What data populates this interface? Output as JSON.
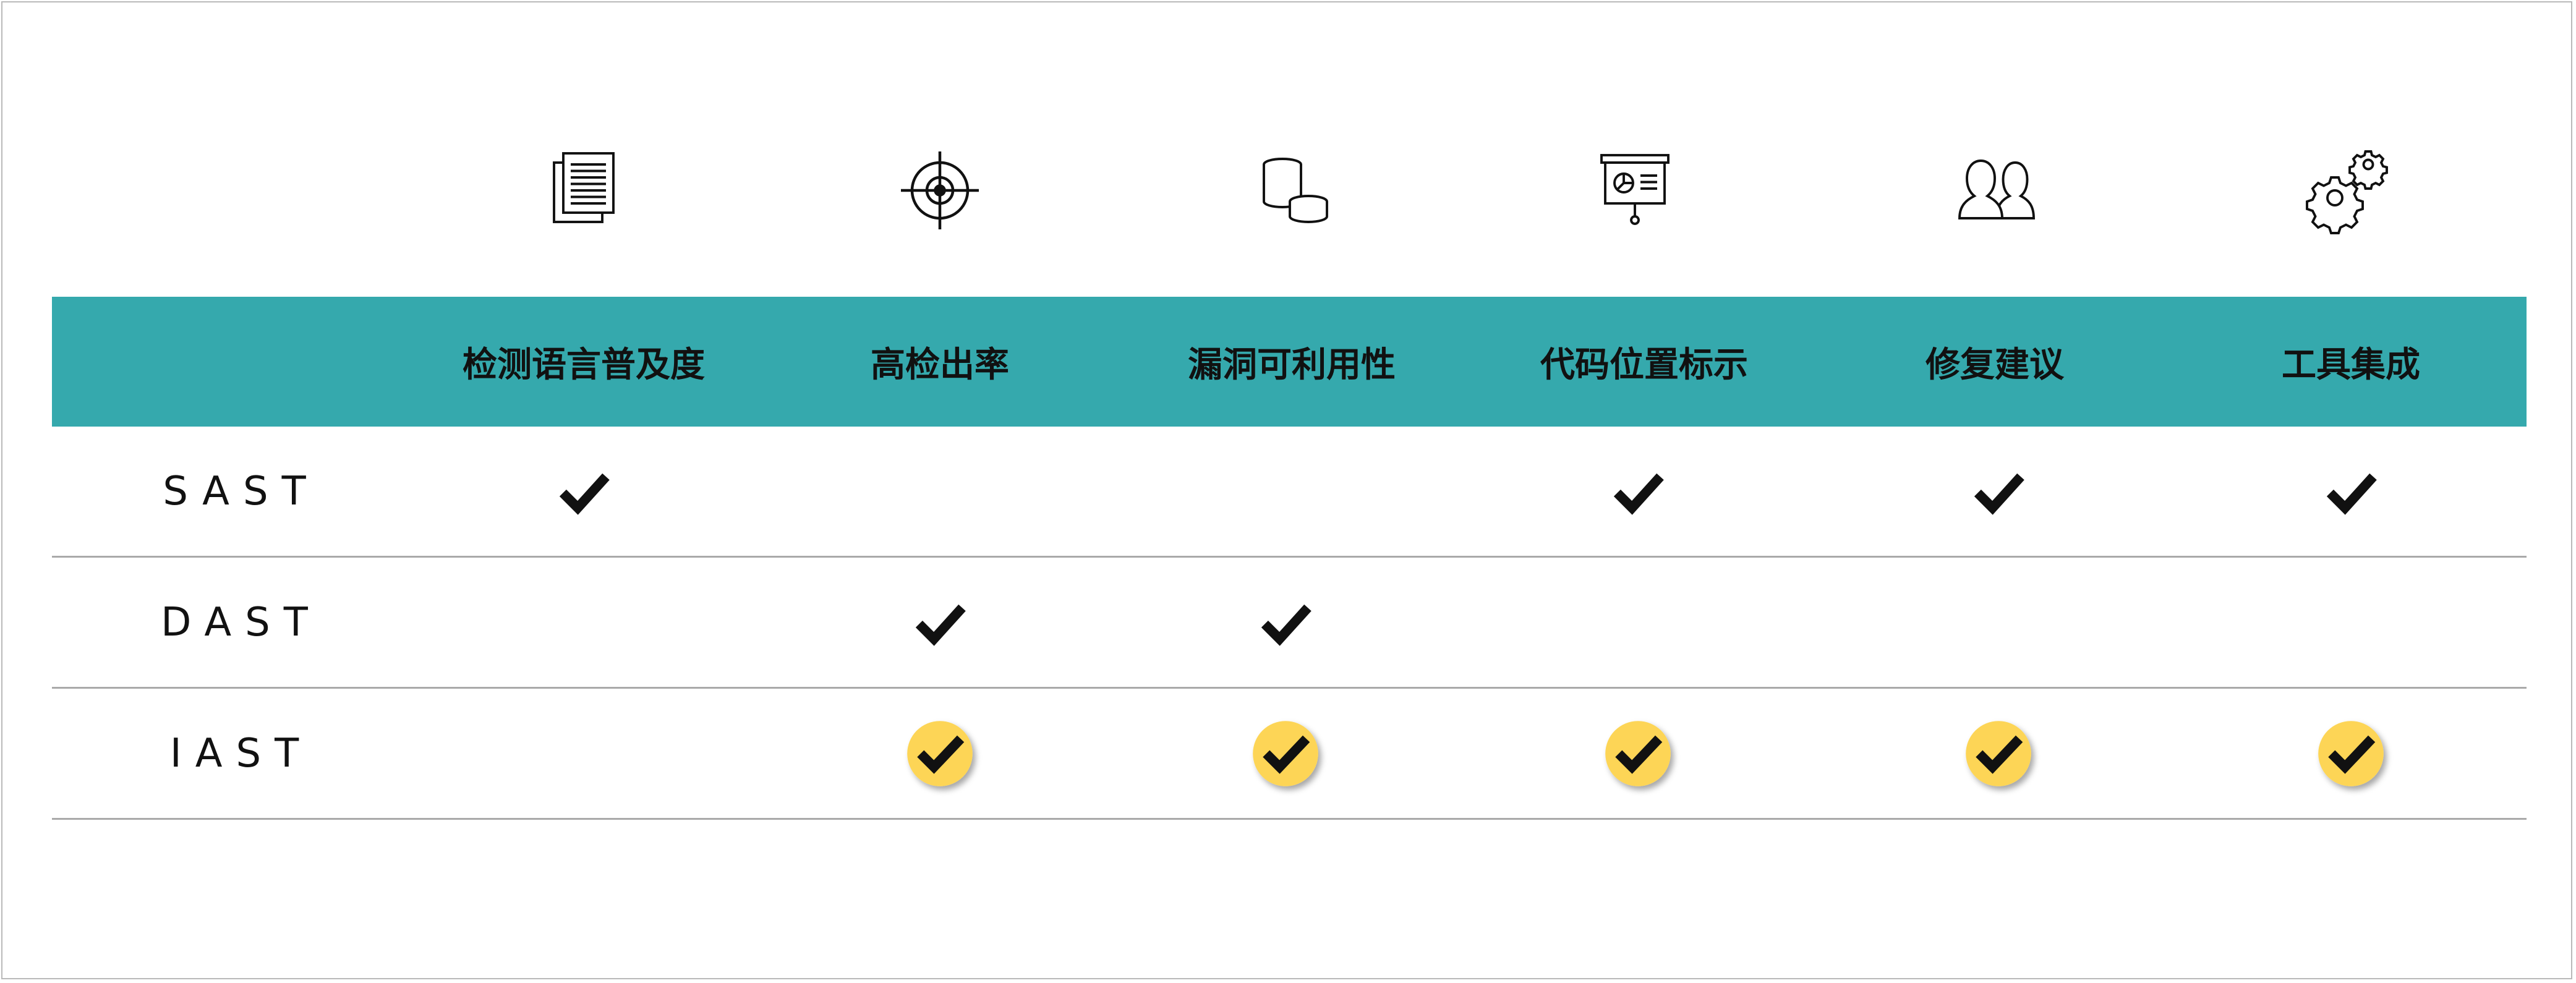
{
  "columns": [
    {
      "key": "coverage",
      "label": "检测语言普及度",
      "icon": "documents-icon"
    },
    {
      "key": "detection",
      "label": "高检出率",
      "icon": "target-icon"
    },
    {
      "key": "exploitability",
      "label": "漏洞可利用性",
      "icon": "coins-icon"
    },
    {
      "key": "location",
      "label": "代码位置标示",
      "icon": "presentation-board-icon"
    },
    {
      "key": "fix",
      "label": "修复建议",
      "icon": "users-icon"
    },
    {
      "key": "integration",
      "label": "工具集成",
      "icon": "gears-icon"
    }
  ],
  "rows": [
    {
      "label": "SAST",
      "style": "plain",
      "checks": [
        true,
        false,
        false,
        true,
        true,
        true
      ]
    },
    {
      "label": "DAST",
      "style": "plain",
      "checks": [
        false,
        true,
        true,
        false,
        false,
        false
      ]
    },
    {
      "label": "IAST",
      "style": "highlight",
      "checks": [
        false,
        true,
        true,
        true,
        true,
        true
      ]
    }
  ],
  "colors": {
    "header_band": "#35a9ad",
    "highlight_badge": "#fdd556",
    "check": "#111111",
    "divider": "#a9a9a9"
  }
}
